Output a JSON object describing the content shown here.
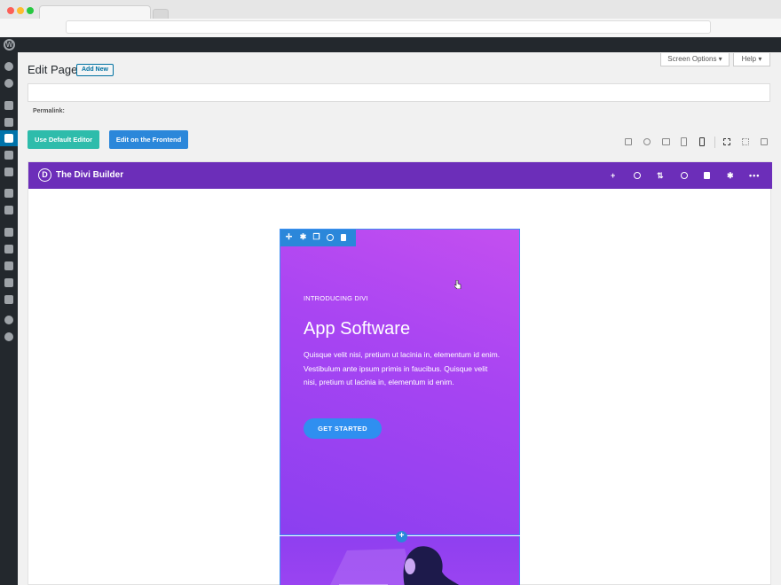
{
  "header": {
    "page_title": "Edit Page",
    "add_new_label": "Add New",
    "screen_options_label": "Screen Options ▾",
    "help_label": "Help ▾"
  },
  "editor": {
    "title_placeholder": "",
    "permalink_label": "Permalink:",
    "use_default_editor_label": "Use Default Editor",
    "edit_frontend_label": "Edit on the Frontend"
  },
  "view_modes": [
    "wireframe-icon",
    "zoom-icon",
    "desktop-icon",
    "tablet-icon",
    "phone-icon",
    "select-icon",
    "click-mode-icon",
    "grid-icon"
  ],
  "divi": {
    "logo_letter": "D",
    "title": "The Divi Builder",
    "header_icons": [
      "plus-icon",
      "power-icon",
      "sort-icon",
      "history-icon",
      "trash-icon",
      "gear-icon",
      "more-icon"
    ]
  },
  "hero": {
    "intro": "INTRODUCING DIVI",
    "title": "App Software",
    "body": "Quisque velit nisi, pretium ut lacinia in, elementum id enim. Vestibulum ante ipsum primis in faucibus. Quisque velit nisi, pretium ut lacinia in, elementum id enim.",
    "cta_label": "GET STARTED"
  },
  "colors": {
    "divi_purple": "#6c2eb9",
    "accent_blue": "#2b87da",
    "teal": "#2ebcab",
    "admin_dark": "#23282d"
  }
}
